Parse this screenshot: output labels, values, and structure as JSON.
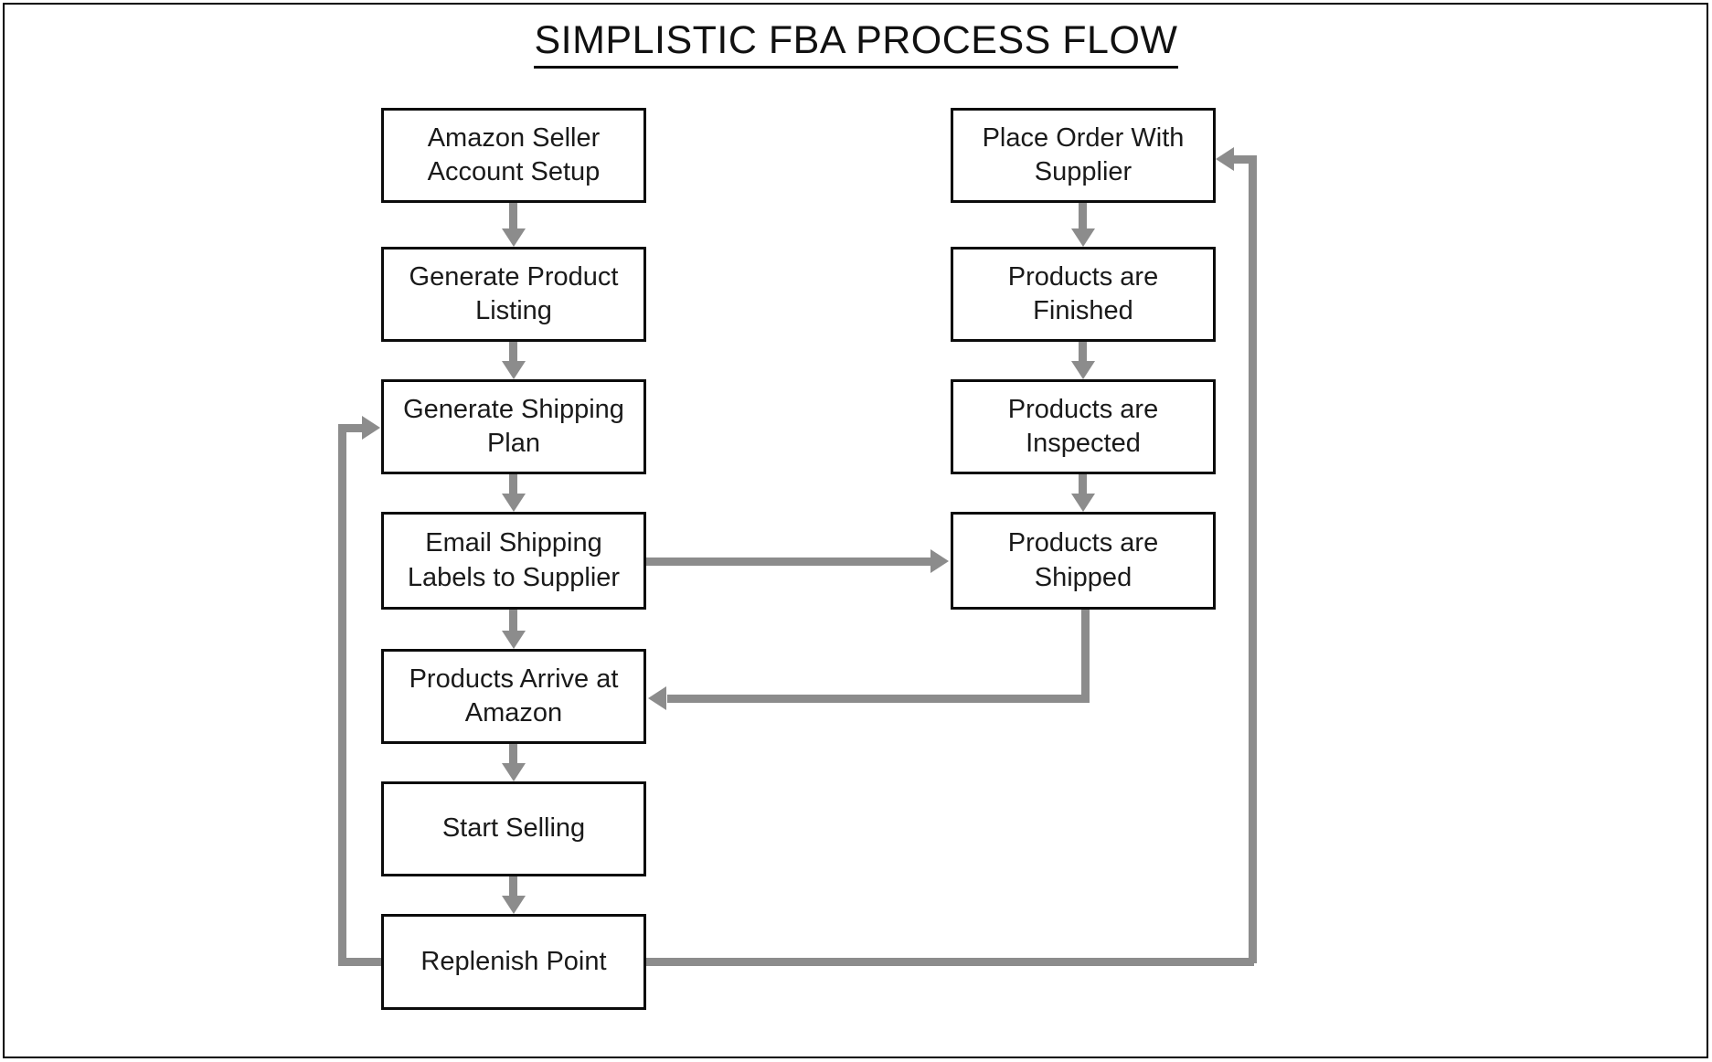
{
  "title": "SIMPLISTIC FBA PROCESS FLOW",
  "colors": {
    "node_border": "#0b0b0b",
    "connector": "#8c8c8c",
    "text": "#1a1a1a",
    "background": "#ffffff",
    "frame": "#000000"
  },
  "chart_data": {
    "type": "diagram",
    "diagram_type": "flowchart",
    "title": "SIMPLISTIC FBA PROCESS FLOW",
    "columns": [
      "left",
      "right"
    ],
    "nodes": [
      {
        "id": "n1",
        "label": "Amazon Seller\nAccount Setup",
        "column": "left",
        "order": 1
      },
      {
        "id": "n2",
        "label": "Generate Product\nListing",
        "column": "left",
        "order": 2
      },
      {
        "id": "n3",
        "label": "Generate Shipping\nPlan",
        "column": "left",
        "order": 3
      },
      {
        "id": "n4",
        "label": "Email Shipping\nLabels to Supplier",
        "column": "left",
        "order": 4
      },
      {
        "id": "n5",
        "label": "Products Arrive at\nAmazon",
        "column": "left",
        "order": 5
      },
      {
        "id": "n6",
        "label": "Start Selling",
        "column": "left",
        "order": 6
      },
      {
        "id": "n7",
        "label": "Replenish Point",
        "column": "left",
        "order": 7
      },
      {
        "id": "n8",
        "label": "Place Order With\nSupplier",
        "column": "right",
        "order": 1
      },
      {
        "id": "n9",
        "label": "Products are\nFinished",
        "column": "right",
        "order": 2
      },
      {
        "id": "n10",
        "label": "Products are\nInspected",
        "column": "right",
        "order": 3
      },
      {
        "id": "n11",
        "label": "Products are\nShipped",
        "column": "right",
        "order": 4
      }
    ],
    "edges": [
      {
        "from": "n1",
        "to": "n2",
        "kind": "straight-down"
      },
      {
        "from": "n2",
        "to": "n3",
        "kind": "straight-down"
      },
      {
        "from": "n3",
        "to": "n4",
        "kind": "straight-down"
      },
      {
        "from": "n4",
        "to": "n5",
        "kind": "straight-down"
      },
      {
        "from": "n5",
        "to": "n6",
        "kind": "straight-down"
      },
      {
        "from": "n6",
        "to": "n7",
        "kind": "straight-down"
      },
      {
        "from": "n4",
        "to": "n11",
        "kind": "horizontal-right"
      },
      {
        "from": "n8",
        "to": "n9",
        "kind": "straight-down"
      },
      {
        "from": "n9",
        "to": "n10",
        "kind": "straight-down"
      },
      {
        "from": "n10",
        "to": "n11",
        "kind": "straight-down"
      },
      {
        "from": "n11",
        "to": "n5",
        "kind": "down-then-left"
      },
      {
        "from": "n7",
        "to": "n3",
        "kind": "left-then-up"
      },
      {
        "from": "n7",
        "to": "n8",
        "kind": "right-then-up"
      }
    ]
  },
  "nodes": {
    "n1": {
      "label": "Amazon Seller\nAccount Setup"
    },
    "n2": {
      "label": "Generate Product\nListing"
    },
    "n3": {
      "label": "Generate Shipping\nPlan"
    },
    "n4": {
      "label": "Email Shipping\nLabels to Supplier"
    },
    "n5": {
      "label": "Products Arrive at\nAmazon"
    },
    "n6": {
      "label": "Start Selling"
    },
    "n7": {
      "label": "Replenish Point"
    },
    "n8": {
      "label": "Place Order With\nSupplier"
    },
    "n9": {
      "label": "Products are\nFinished"
    },
    "n10": {
      "label": "Products are\nInspected"
    },
    "n11": {
      "label": "Products are\nShipped"
    }
  }
}
